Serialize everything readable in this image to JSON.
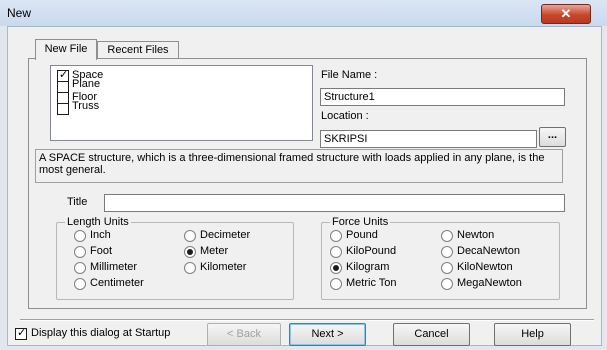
{
  "window": {
    "title": "New",
    "close_icon": "close-icon"
  },
  "tabs": [
    {
      "label": "New File"
    },
    {
      "label": "Recent Files"
    }
  ],
  "structure_types": [
    {
      "label": "Space",
      "checked": true
    },
    {
      "label": "Plane",
      "checked": false
    },
    {
      "label": "Floor",
      "checked": false
    },
    {
      "label": "Truss",
      "checked": false
    }
  ],
  "file_name": {
    "label": "File Name :",
    "value": "Structure1"
  },
  "location": {
    "label": "Location :",
    "value": "SKRIPSI",
    "browse_label": "..."
  },
  "description": "A SPACE structure, which is a three-dimensional framed structure with loads applied in any plane, is the most general.",
  "title_field": {
    "label": "Title",
    "value": ""
  },
  "length_units": {
    "title": "Length Units",
    "options": [
      "Inch",
      "Foot",
      "Millimeter",
      "Centimeter",
      "Decimeter",
      "Meter",
      "Kilometer"
    ],
    "selected": "Meter"
  },
  "force_units": {
    "title": "Force Units",
    "options": [
      "Pound",
      "KiloPound",
      "Kilogram",
      "Metric Ton",
      "Newton",
      "DecaNewton",
      "KiloNewton",
      "MegaNewton"
    ],
    "selected": "Kilogram"
  },
  "footer": {
    "startup_label": "Display this dialog at Startup",
    "startup_checked": true,
    "back_label": "< Back",
    "next_label": "Next >",
    "cancel_label": "Cancel",
    "help_label": "Help"
  }
}
